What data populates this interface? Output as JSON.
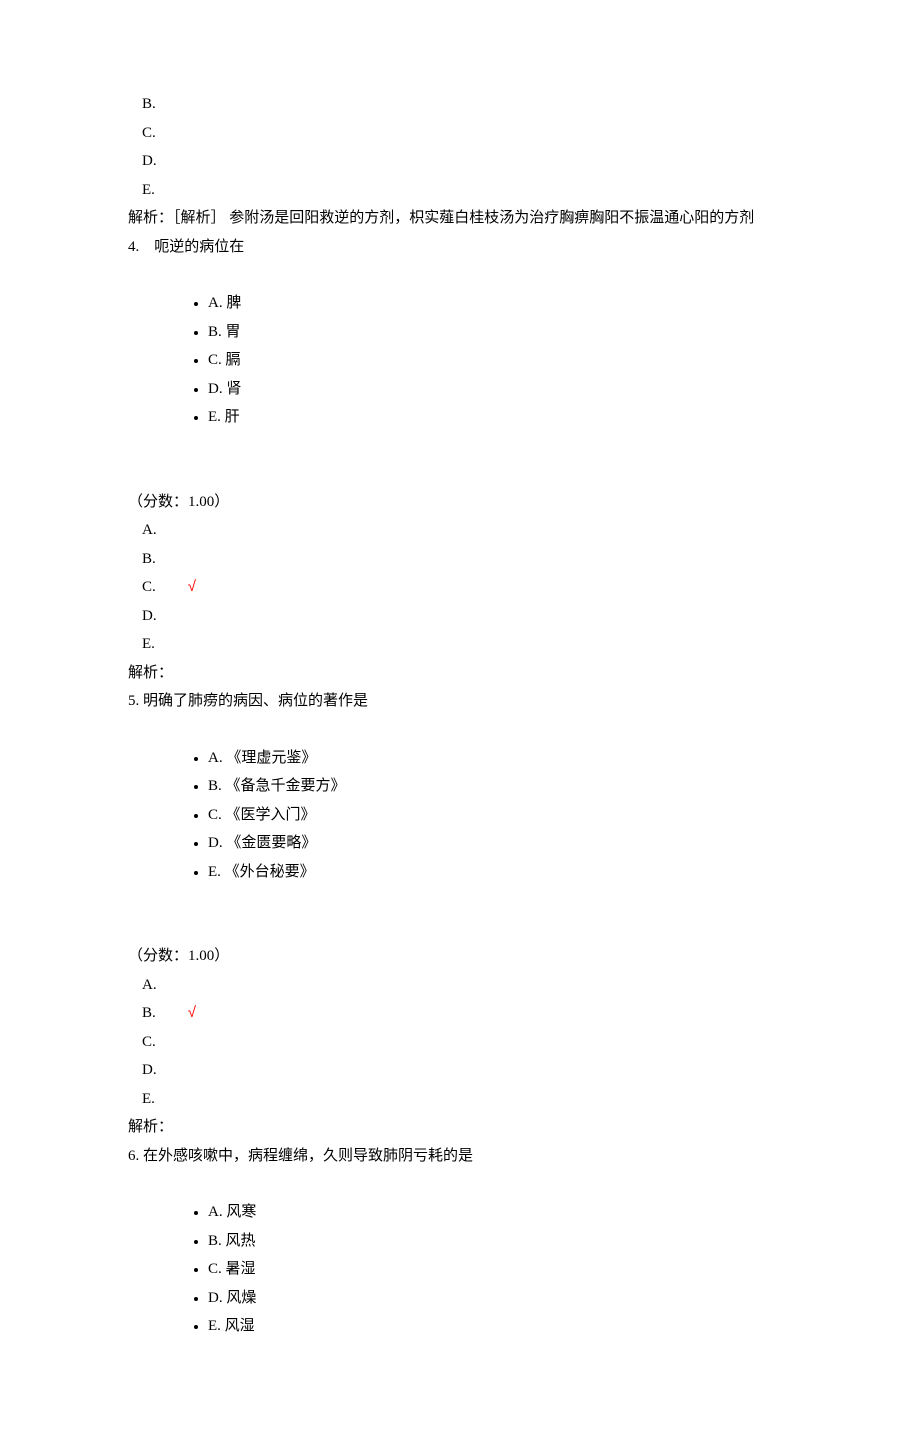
{
  "q3_tail": {
    "ans_B": "B.",
    "ans_C": "C.",
    "ans_D": "D.",
    "ans_E": "E.",
    "explanation": "解析：［解析］ 参附汤是回阳救逆的方剂，枳实薤白桂枝汤为治疗胸痹胸阳不振温通心阳的方剂"
  },
  "q4": {
    "stem_prefix": "4.",
    "stem_text": "呃逆的病位在",
    "options": {
      "A": "A. 脾",
      "B": "B. 胃",
      "C": "C. 膈",
      "D": "D. 肾",
      "E": "E. 肝"
    },
    "score": "（分数：1.00）",
    "ans_A": "A.",
    "ans_B": "B.",
    "ans_C": "C.",
    "ans_D": "D.",
    "ans_E": "E.",
    "correct_mark": "√",
    "explanation": "解析："
  },
  "q5": {
    "stem_prefix": "5.",
    "stem_text": "明确了肺痨的病因、病位的著作是",
    "options": {
      "A": "A. 《理虚元鉴》",
      "B": "B. 《备急千金要方》",
      "C": "C. 《医学入门》",
      "D": "D. 《金匮要略》",
      "E": "E. 《外台秘要》"
    },
    "score": "（分数：1.00）",
    "ans_A": "A.",
    "ans_B": "B.",
    "ans_C": "C.",
    "ans_D": "D.",
    "ans_E": "E.",
    "correct_mark": "√",
    "explanation": "解析："
  },
  "q6": {
    "stem_prefix": "6.",
    "stem_text": "在外感咳嗽中，病程缠绵，久则导致肺阴亏耗的是",
    "options": {
      "A": "A. 风寒",
      "B": "B. 风热",
      "C": "C. 暑湿",
      "D": "D. 风燥",
      "E": "E. 风湿"
    }
  }
}
